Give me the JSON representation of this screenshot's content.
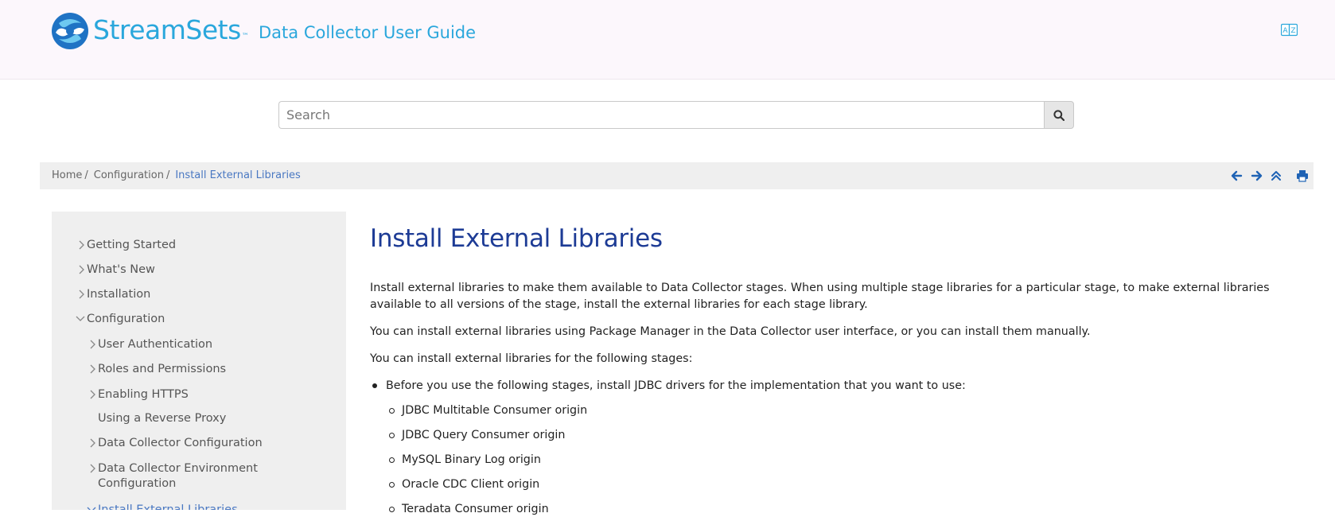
{
  "header": {
    "brand": "StreamSets",
    "brand_tm": "™",
    "guide_title": "Data Collector User Guide",
    "brand_color": "#2aa7dc",
    "language_icon": "language-icon"
  },
  "search": {
    "placeholder": "Search",
    "value": "",
    "button_icon": "search-icon"
  },
  "breadcrumb": {
    "items": [
      "Home",
      "Configuration"
    ],
    "separator": "/",
    "current": "Install External Libraries"
  },
  "nav_icons": [
    "arrow-left-icon",
    "arrow-right-icon",
    "double-chevron-up-icon",
    "print-icon"
  ],
  "sidebar": {
    "items": [
      {
        "label": "Getting Started",
        "icon": "chevron-right-icon"
      },
      {
        "label": "What's New",
        "icon": "chevron-right-icon"
      },
      {
        "label": "Installation",
        "icon": "chevron-right-icon"
      },
      {
        "label": "Configuration",
        "icon": "chevron-down-icon"
      },
      {
        "label": "User Authentication",
        "icon": "chevron-right-icon"
      },
      {
        "label": "Roles and Permissions",
        "icon": "chevron-right-icon"
      },
      {
        "label": "Enabling HTTPS",
        "icon": "chevron-right-icon"
      },
      {
        "label": "Using a Reverse Proxy",
        "icon": ""
      },
      {
        "label": "Data Collector Configuration",
        "icon": "chevron-right-icon"
      },
      {
        "label": "Data Collector Environment Configuration",
        "line1": "Data Collector Environment",
        "line2": "Configuration",
        "icon": "chevron-right-icon"
      },
      {
        "label": "Install External Libraries",
        "icon": "chevron-down-icon",
        "active": true
      }
    ]
  },
  "main": {
    "title": "Install External Libraries",
    "para1_line1": "Install external libraries to make them available to Data Collector stages. When using multiple stage libraries for a particular stage, to make external libraries",
    "para1_line2": "available to all versions of the stage, install the external libraries for each stage library.",
    "para2": "You can install external libraries using Package Manager in the Data Collector user interface, or you can install them manually.",
    "para3": "You can install external libraries for the following stages:",
    "bullet1": "Before you use the following stages, install JDBC drivers for the implementation that you want to use:",
    "sub_bullets": [
      "JDBC Multitable Consumer origin",
      "JDBC Query Consumer origin",
      "MySQL Binary Log origin",
      "Oracle CDC Client origin",
      "Teradata Consumer origin"
    ]
  },
  "colors": {
    "title": "#1d3b95",
    "link_active": "#4a78c2",
    "header_bg": "#fcf7fc",
    "panel_bg": "#efefef"
  }
}
